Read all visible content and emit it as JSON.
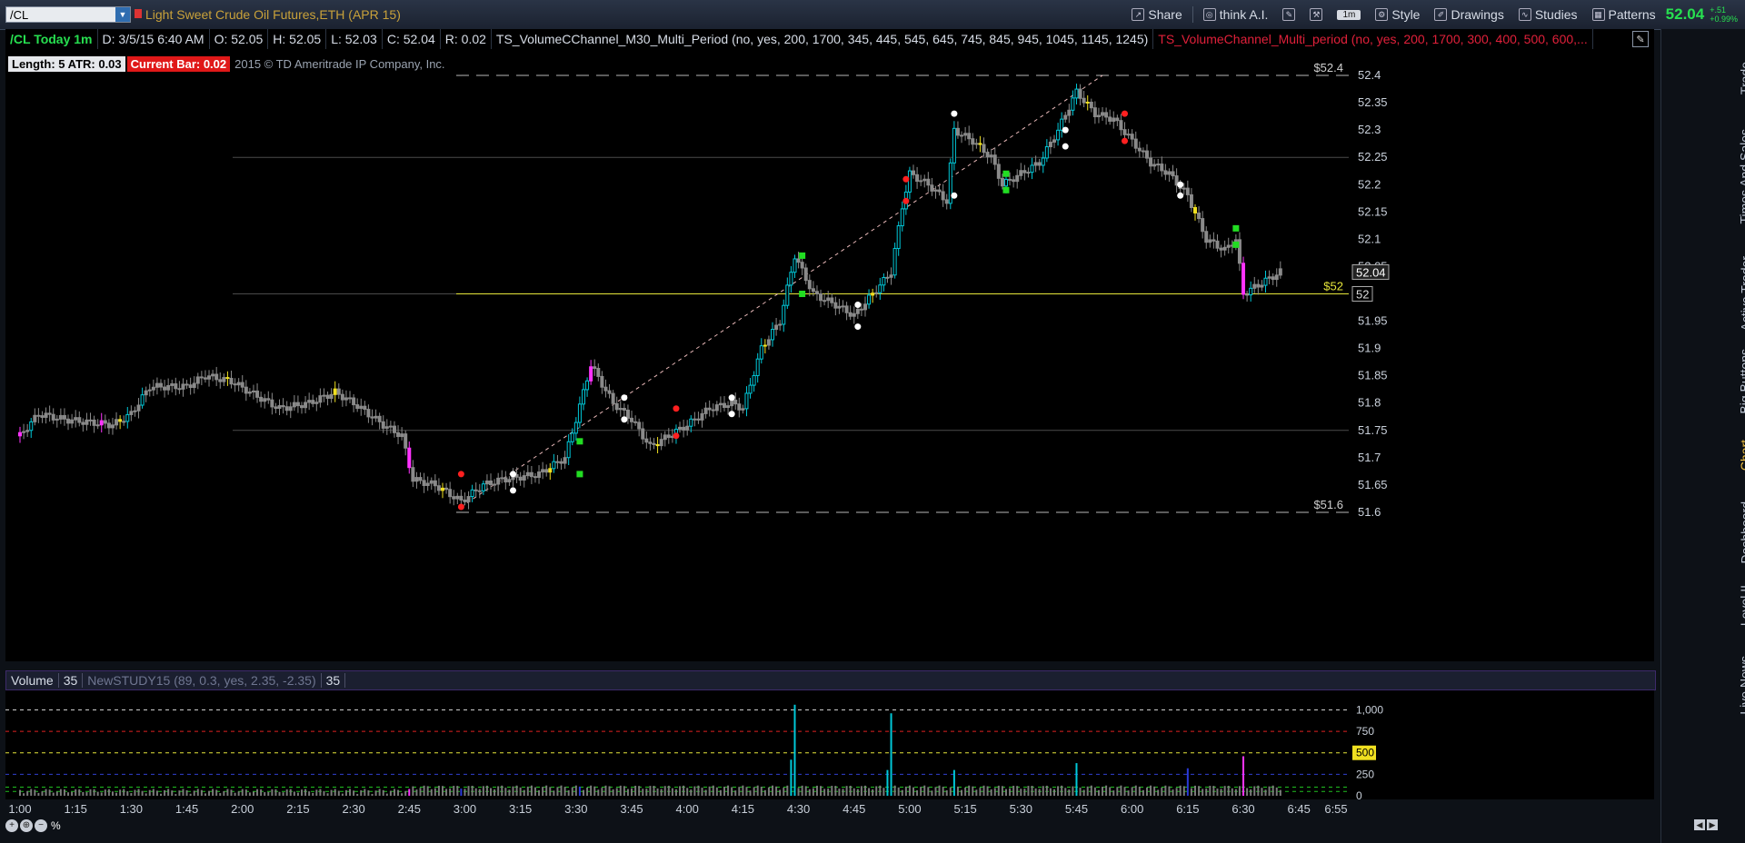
{
  "topbar": {
    "symbol": "/CL",
    "instrument_title": "Light Sweet Crude Oil Futures,ETH (APR 15)",
    "buttons": {
      "share": "Share",
      "think_ai": "think A.I.",
      "timeframe_badge": "1m",
      "style": "Style",
      "drawings": "Drawings",
      "studies": "Studies",
      "patterns": "Patterns"
    },
    "last_price": "52.04",
    "change_abs": "+.51",
    "change_pct": "+0.99%"
  },
  "infobar": {
    "symbol_label": "/CL Today 1m",
    "date": "D: 3/5/15 6:40 AM",
    "open": "O: 52.05",
    "high": "H: 52.05",
    "low": "L: 52.03",
    "close": "C: 52.04",
    "range": "R: 0.02",
    "study1": "TS_VolumeCChannel_M30_Multi_Period (no, yes, 200, 1700, 345, 445, 545, 645, 745, 845, 945, 1045, 1145, 1245)",
    "study2": "TS_VolumeChannel_Multi_period (no, yes, 200, 1700, 300, 400, 500, 600,..."
  },
  "chips": {
    "length": "Length: 5",
    "atr": "ATR: 0.03",
    "current_bar": "Current Bar: 0.02",
    "copyright": "2015 © TD Ameritrade IP Company, Inc."
  },
  "volume_header": {
    "label": "Volume",
    "value": "35",
    "study": "NewSTUDY15 (89, 0.3, yes, 2.35, -2.35)",
    "study_value": "35"
  },
  "right_rail_tabs": [
    "Trade",
    "Times And Sales",
    "Active Trader",
    "Big Buttons",
    "Chart",
    "Dashboard",
    "Level II",
    "Live News"
  ],
  "right_rail_active": "Chart",
  "zoom": {
    "percent": "%"
  },
  "colors": {
    "background": "#000000",
    "candle_up": "#00c8d8",
    "candle_down": "#8a8a8a",
    "doji_yellow": "#f0e020",
    "magenta": "#ff33ff",
    "level_line": "#e6e63a",
    "accent_green": "#27e050",
    "channel_dots_red": "#ff2020",
    "channel_dots_white": "#ffffff",
    "channel_squares_green": "#22dd22"
  },
  "chart_data": [
    {
      "type": "candlestick",
      "x_axis": {
        "ticks": [
          "1:00",
          "1:15",
          "1:30",
          "1:45",
          "2:00",
          "2:15",
          "2:30",
          "2:45",
          "3:00",
          "3:15",
          "3:30",
          "3:45",
          "4:00",
          "4:15",
          "4:30",
          "4:45",
          "5:00",
          "5:15",
          "5:30",
          "5:45",
          "6:00",
          "6:15",
          "6:30",
          "6:45",
          "6:55"
        ]
      },
      "y_axis": {
        "ticks": [
          "52.4",
          "52.35",
          "52.3",
          "52.25",
          "52.2",
          "52.15",
          "52.1",
          "52.05",
          "52",
          "51.95",
          "51.9",
          "51.85",
          "51.8",
          "51.75",
          "51.7",
          "51.65",
          "51.6"
        ],
        "ylim": [
          51.58,
          52.425
        ],
        "last_price_label": "52.04",
        "level_label": "52"
      },
      "levels": [
        {
          "label": "$52.4",
          "value": 52.4,
          "style": "dashed"
        },
        {
          "label": "$52",
          "value": 52.0,
          "style": "solid-yellow"
        },
        {
          "label": "$51.6",
          "value": 51.6,
          "style": "dashed"
        }
      ],
      "channel_lines": [
        52.25,
        52.0,
        51.75
      ],
      "trendline": {
        "from": [
          "2:59",
          51.61
        ],
        "to": [
          "5:52",
          52.4
        ]
      },
      "close_path": [
        [
          "1:00",
          51.74
        ],
        [
          "1:05",
          51.78
        ],
        [
          "1:12",
          51.77
        ],
        [
          "1:25",
          51.76
        ],
        [
          "1:30",
          51.78
        ],
        [
          "1:35",
          51.83
        ],
        [
          "1:45",
          51.83
        ],
        [
          "1:50",
          51.85
        ],
        [
          "1:57",
          51.84
        ],
        [
          "2:02",
          51.82
        ],
        [
          "2:10",
          51.79
        ],
        [
          "2:18",
          51.8
        ],
        [
          "2:25",
          51.82
        ],
        [
          "2:30",
          51.8
        ],
        [
          "2:38",
          51.76
        ],
        [
          "2:43",
          51.74
        ],
        [
          "2:46",
          51.66
        ],
        [
          "2:52",
          51.65
        ],
        [
          "2:59",
          51.62
        ],
        [
          "3:05",
          51.65
        ],
        [
          "3:10",
          51.66
        ],
        [
          "3:20",
          51.67
        ],
        [
          "3:27",
          51.7
        ],
        [
          "3:30",
          51.77
        ],
        [
          "3:34",
          51.87
        ],
        [
          "3:40",
          51.8
        ],
        [
          "3:45",
          51.77
        ],
        [
          "3:50",
          51.72
        ],
        [
          "3:55",
          51.74
        ],
        [
          "4:00",
          51.76
        ],
        [
          "4:06",
          51.79
        ],
        [
          "4:12",
          51.8
        ],
        [
          "4:15",
          51.79
        ],
        [
          "4:20",
          51.9
        ],
        [
          "4:25",
          51.95
        ],
        [
          "4:29",
          52.07
        ],
        [
          "4:34",
          52.0
        ],
        [
          "4:40",
          51.98
        ],
        [
          "4:45",
          51.96
        ],
        [
          "4:50",
          52.0
        ],
        [
          "4:55",
          52.04
        ],
        [
          "4:58",
          52.16
        ],
        [
          "5:00",
          52.22
        ],
        [
          "5:05",
          52.2
        ],
        [
          "5:10",
          52.17
        ],
        [
          "5:12",
          52.3
        ],
        [
          "5:17",
          52.28
        ],
        [
          "5:22",
          52.25
        ],
        [
          "5:25",
          52.2
        ],
        [
          "5:30",
          52.22
        ],
        [
          "5:35",
          52.24
        ],
        [
          "5:40",
          52.3
        ],
        [
          "5:45",
          52.37
        ],
        [
          "5:50",
          52.33
        ],
        [
          "5:55",
          52.32
        ],
        [
          "6:00",
          52.28
        ],
        [
          "6:05",
          52.24
        ],
        [
          "6:10",
          52.22
        ],
        [
          "6:15",
          52.18
        ],
        [
          "6:20",
          52.1
        ],
        [
          "6:25",
          52.08
        ],
        [
          "6:28",
          52.1
        ],
        [
          "6:30",
          52.0
        ],
        [
          "6:35",
          52.02
        ],
        [
          "6:40",
          52.04
        ]
      ]
    },
    {
      "type": "bar",
      "name": "Volume",
      "y_axis": {
        "ticks": [
          "1,000",
          "750",
          "500",
          "250",
          "0"
        ],
        "ylim": [
          0,
          1100
        ],
        "highlight_label": "500"
      },
      "reference_lines": [
        1000,
        750,
        500,
        250,
        100,
        50
      ],
      "spikes": [
        [
          "4:29",
          1060
        ],
        [
          "4:28",
          420
        ],
        [
          "4:55",
          960
        ],
        [
          "4:54",
          300
        ],
        [
          "5:12",
          300
        ],
        [
          "5:45",
          380
        ],
        [
          "6:15",
          320
        ],
        [
          "6:30",
          460
        ]
      ]
    }
  ]
}
